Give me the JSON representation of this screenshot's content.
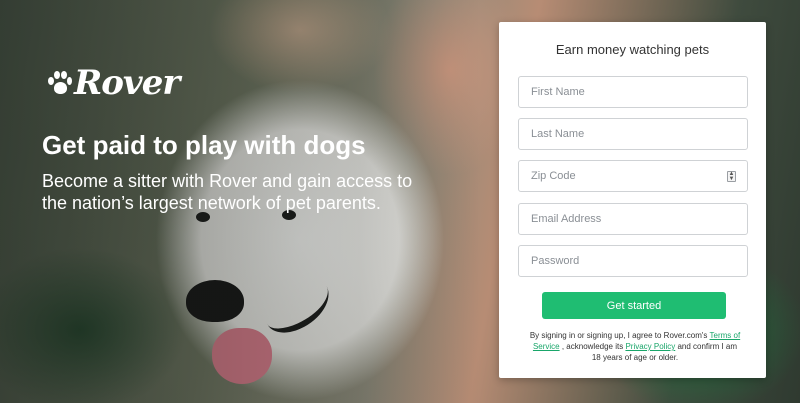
{
  "brand": {
    "logo_text": "Rover"
  },
  "hero": {
    "headline": "Get paid to play with dogs",
    "subheadline": "Become a sitter with Rover and gain access to the nation’s largest network of pet parents."
  },
  "signup": {
    "title": "Earn money watching pets",
    "fields": {
      "first_name": {
        "placeholder": "First Name",
        "value": ""
      },
      "last_name": {
        "placeholder": "Last Name",
        "value": ""
      },
      "zip_code": {
        "placeholder": "Zip Code",
        "value": ""
      },
      "email": {
        "placeholder": "Email Address",
        "value": ""
      },
      "password": {
        "placeholder": "Password",
        "value": ""
      }
    },
    "submit_label": "Get started",
    "legal": {
      "prefix": "By signing in or signing up, I agree to Rover.com's ",
      "terms_link": "Terms of Service",
      "middle": " , acknowledge its ",
      "privacy_link": "Privacy Policy",
      "suffix": "  and confirm I am 18 years of age or older."
    }
  },
  "colors": {
    "accent": "#1fbd72",
    "link": "#19a66a",
    "card_bg": "#ffffff"
  },
  "icons": {
    "logo": "paw-icon",
    "spinner": "number-spinner-icon"
  }
}
